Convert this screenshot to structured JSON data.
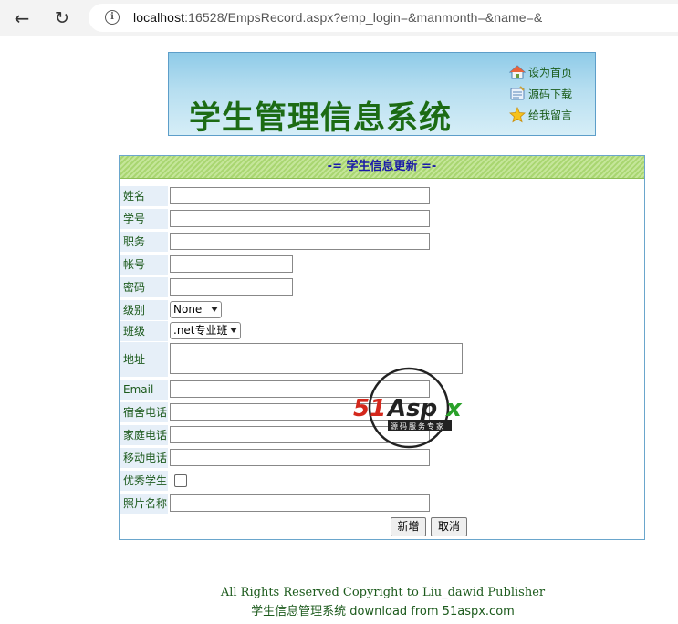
{
  "browser": {
    "url_host": "localhost",
    "url_rest": ":16528/EmpsRecord.aspx?emp_login=&manmonth=&name=&"
  },
  "banner": {
    "title": "学生管理信息系统",
    "links": [
      {
        "label": "设为首页",
        "icon": "home-icon"
      },
      {
        "label": "源码下载",
        "icon": "download-icon"
      },
      {
        "label": "给我留言",
        "icon": "star-icon"
      }
    ]
  },
  "form": {
    "title": "-= 学生信息更新 =-",
    "fields": {
      "name": "姓名",
      "student_no": "学号",
      "position": "职务",
      "account": "帐号",
      "password": "密码",
      "level": "级别",
      "class": "班级",
      "address": "地址",
      "email": "Email",
      "dorm_phone": "宿舍电话",
      "home_phone": "家庭电话",
      "mobile": "移动电话",
      "excellent": "优秀学生",
      "photo": "照片名称"
    },
    "level_value": "None",
    "class_value": ".net专业班",
    "buttons": {
      "add": "新增",
      "cancel": "取消"
    }
  },
  "watermark": {
    "brand": "51Aspx",
    "tagline": "源码服务专家"
  },
  "footer": {
    "line1": "All Rights Reserved    Copyright to Liu_dawid Publisher",
    "line2": "学生信息管理系统 download from 51aspx.com"
  },
  "colors": {
    "accent_green": "#1c6b14",
    "header_blue": "#1a1aa8",
    "border_blue": "#6aa6cc"
  }
}
